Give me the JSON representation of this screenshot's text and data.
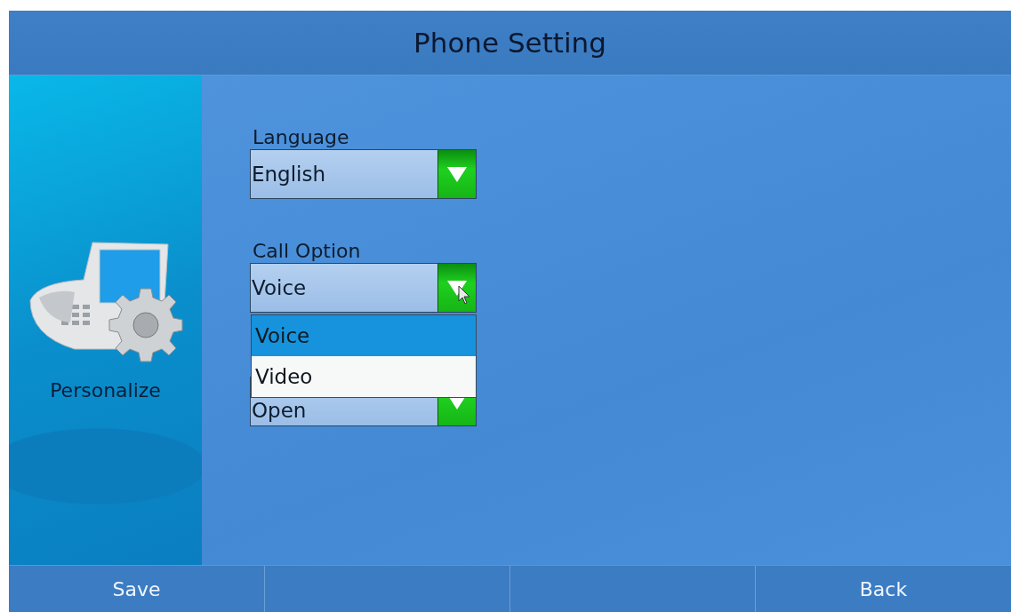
{
  "title": "Phone Setting",
  "sidebar": {
    "label": "Personalize"
  },
  "fields": [
    {
      "label": "Language",
      "value": "English",
      "open": false
    },
    {
      "label": "Call Option",
      "value": "Voice",
      "open": true,
      "options": [
        {
          "label": "Voice",
          "selected": true
        },
        {
          "label": "Video",
          "selected": false
        }
      ]
    },
    {
      "value": "Open",
      "open": false
    }
  ],
  "softkeys": [
    {
      "kind": "button",
      "label": "Save"
    },
    {
      "kind": "blank"
    },
    {
      "kind": "blank"
    },
    {
      "kind": "button",
      "label": "Back"
    }
  ]
}
